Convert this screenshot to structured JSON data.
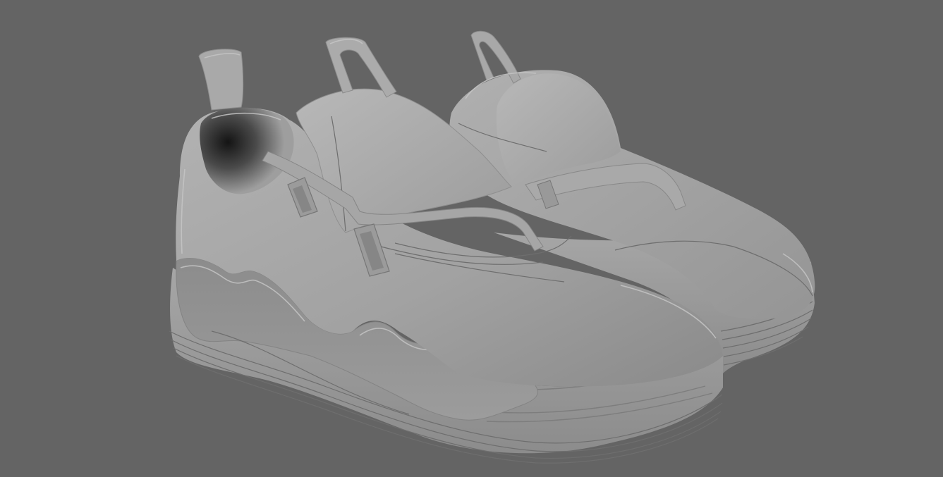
{
  "viewport": {
    "background_color": "#646464",
    "shading_mode": "smooth-shaded-grey",
    "model_color": "#a3a3a3"
  },
  "model": {
    "objects": [
      {
        "role": "sneaker-left"
      },
      {
        "role": "sneaker-right"
      }
    ]
  }
}
